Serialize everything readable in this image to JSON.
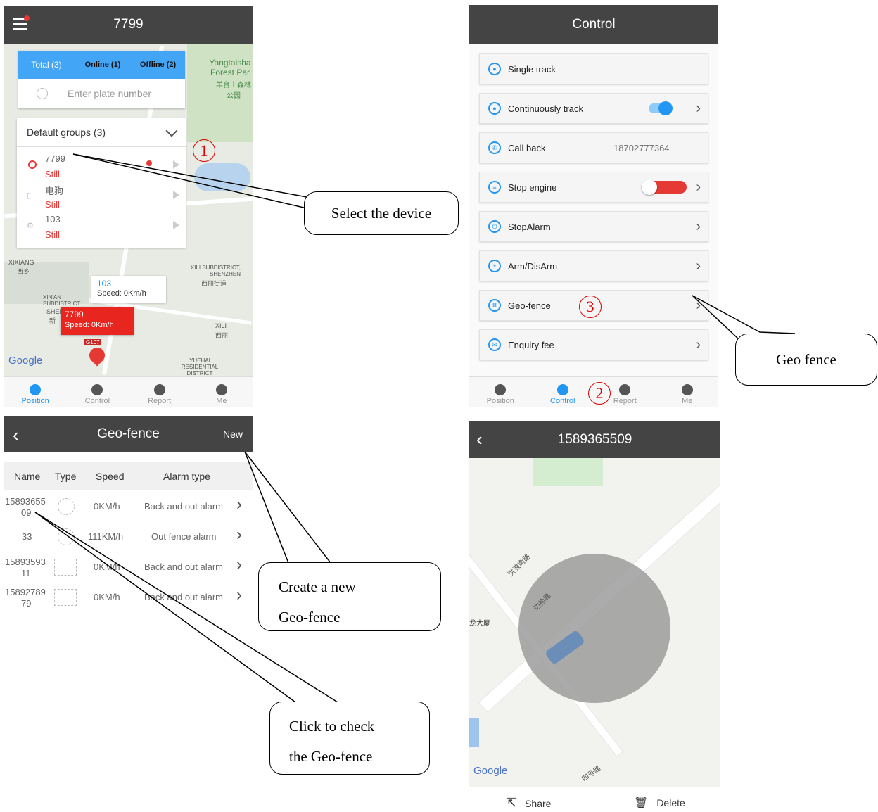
{
  "panel1": {
    "title": "7799",
    "tabs": {
      "total": "Total (3)",
      "online": "Online (1)",
      "offline": "Offline (2)"
    },
    "search_placeholder": "Enter plate number",
    "group": "Default groups (3)",
    "devices": [
      {
        "name": "7799",
        "status": "Still"
      },
      {
        "name": "电狗",
        "status": "Still"
      },
      {
        "name": "103",
        "status": "Still"
      }
    ],
    "map_labels": {
      "park": "Yangtaisha Forest Par",
      "park_cn": "羊台山森林公园",
      "xixiang": "XIXIANG",
      "xixiang_cn": "西乡",
      "xili_sub": "XILI SUBDISTRICT, SHENZHEN",
      "xili_sub_cn": "西丽街道",
      "xinan": "XIN'AN SUBDISTRICT",
      "shei": "SHEI",
      "xin": "新",
      "xili": "XILI",
      "xili_cn": "西丽",
      "yuehai": "YUEHAI RESIDENTIAL DISTRICT",
      "g107": "G107",
      "google": "Google"
    },
    "popup_103": {
      "name": "103",
      "speed": "Speed: 0Km/h"
    },
    "popup_7799": {
      "name": "7799",
      "speed": "Speed: 0Km/h"
    },
    "nav": [
      "Position",
      "Control",
      "Report",
      "Me"
    ]
  },
  "panel2": {
    "title": "Control",
    "rows": [
      {
        "label": "Single track",
        "value": ""
      },
      {
        "label": "Continuously track",
        "value": ""
      },
      {
        "label": "Call back",
        "value": "18702777364"
      },
      {
        "label": "Stop engine",
        "value": ""
      },
      {
        "label": "StopAlarm",
        "value": ""
      },
      {
        "label": "Arm/DisArm",
        "value": ""
      },
      {
        "label": "Geo-fence",
        "value": ""
      },
      {
        "label": "Enquiry fee",
        "value": ""
      }
    ],
    "nav": [
      "Position",
      "Control",
      "Report",
      "Me"
    ]
  },
  "panel3": {
    "title": "Geo-fence",
    "new_label": "New",
    "columns": [
      "Name",
      "Type",
      "Speed",
      "Alarm type"
    ],
    "rows": [
      {
        "name1": "15893655",
        "name2": "09",
        "speed": "0KM/h",
        "alarm": "Back and out alarm"
      },
      {
        "name1": "33",
        "name2": "",
        "speed": "111KM/h",
        "alarm": "Out fence alarm"
      },
      {
        "name1": "15893593",
        "name2": "11",
        "speed": "0KM/h",
        "alarm": "Back and out alarm"
      },
      {
        "name1": "15892789",
        "name2": "79",
        "speed": "0KM/h",
        "alarm": "Back and out alarm"
      }
    ]
  },
  "panel4": {
    "title": "1589365509",
    "map_labels": {
      "road1": "洪浪南路",
      "road2": "边检路",
      "bldg": "龙大厦",
      "road3": "四号路",
      "google": "Google"
    },
    "share": "Share",
    "delete": "Delete"
  },
  "annotations": {
    "select_device": "Select the device",
    "geo_fence": "Geo fence",
    "create_new_1": "Create a new",
    "create_new_2": "Geo-fence",
    "click_check_1": "Click to check",
    "click_check_2": "the Geo-fence",
    "num1": "1",
    "num2": "2",
    "num3": "3"
  },
  "colors": {
    "header": "#444444",
    "accent": "#2196f3",
    "alert": "#e53935"
  }
}
